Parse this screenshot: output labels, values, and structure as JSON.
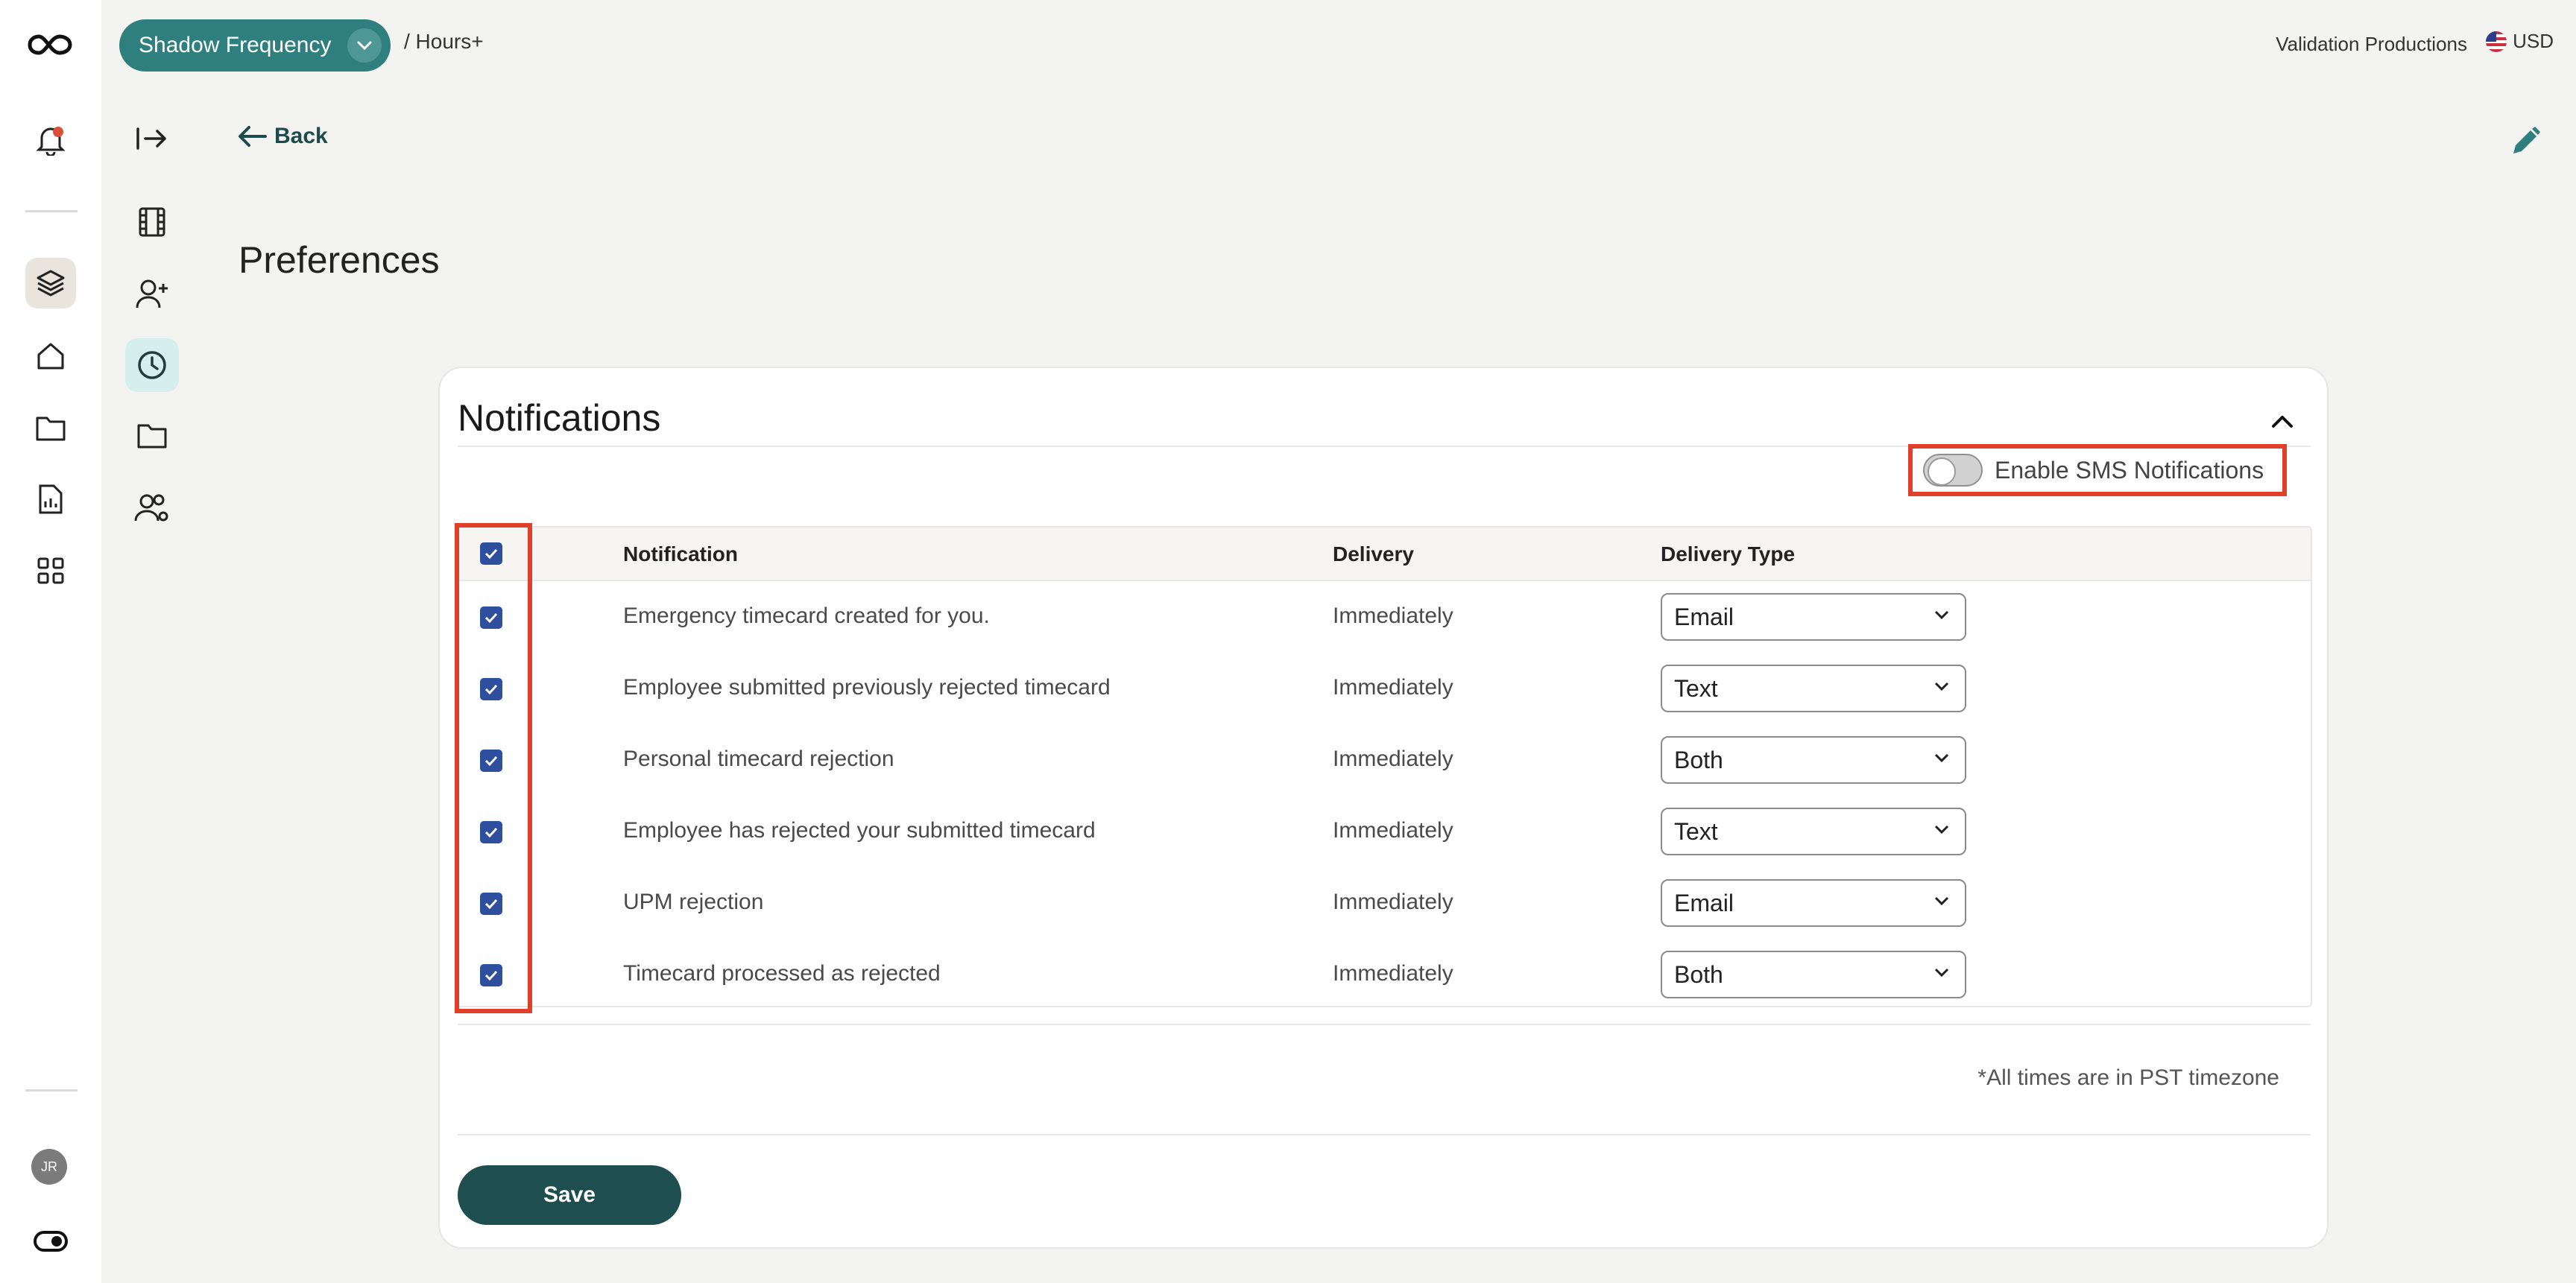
{
  "header": {
    "project_name": "Shadow Frequency",
    "breadcrumb": "/ Hours+",
    "company": "Validation Productions",
    "currency": "USD"
  },
  "nav": {
    "back_label": "Back"
  },
  "page": {
    "title": "Preferences"
  },
  "avatar": {
    "initials": "JR"
  },
  "notifications": {
    "title": "Notifications",
    "sms_label": "Enable SMS Notifications",
    "sms_enabled": false,
    "columns": {
      "notification": "Notification",
      "delivery": "Delivery",
      "delivery_type": "Delivery Type"
    },
    "rows": [
      {
        "notification": "Emergency timecard created for you.",
        "delivery": "Immediately",
        "delivery_type": "Email",
        "checked": true
      },
      {
        "notification": "Employee submitted previously rejected timecard",
        "delivery": "Immediately",
        "delivery_type": "Text",
        "checked": true
      },
      {
        "notification": "Personal timecard rejection",
        "delivery": "Immediately",
        "delivery_type": "Both",
        "checked": true
      },
      {
        "notification": "Employee has rejected your submitted timecard",
        "delivery": "Immediately",
        "delivery_type": "Text",
        "checked": true
      },
      {
        "notification": "UPM rejection",
        "delivery": "Immediately",
        "delivery_type": "Email",
        "checked": true
      },
      {
        "notification": "Timecard processed as rejected",
        "delivery": "Immediately",
        "delivery_type": "Both",
        "checked": true
      }
    ],
    "timezone_note": "*All times are in PST timezone",
    "save_label": "Save"
  },
  "colors": {
    "accent": "#2e7f7e",
    "highlight": "#e0402a",
    "checkbox": "#2d4f9e",
    "save": "#1e4e4d"
  }
}
